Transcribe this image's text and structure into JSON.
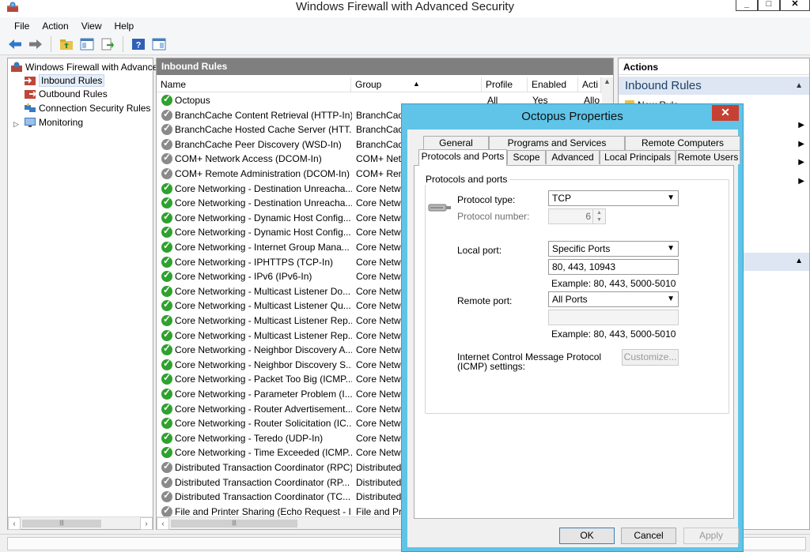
{
  "window": {
    "title": "Windows Firewall with Advanced Security"
  },
  "menu": [
    "File",
    "Action",
    "View",
    "Help"
  ],
  "tree": {
    "root": "Windows Firewall with Advance",
    "items": [
      "Inbound Rules",
      "Outbound Rules",
      "Connection Security Rules",
      "Monitoring"
    ]
  },
  "rules": {
    "header": "Inbound Rules",
    "columns": {
      "name": "Name",
      "group": "Group",
      "profile": "Profile",
      "enabled": "Enabled",
      "action": "Acti"
    },
    "rows": [
      {
        "name": "Octopus",
        "group": "",
        "profile": "All",
        "enabled": "Yes",
        "action": "Allo",
        "on": true
      },
      {
        "name": "BranchCache Content Retrieval (HTTP-In)",
        "group": "BranchCach",
        "on": false
      },
      {
        "name": "BranchCache Hosted Cache Server (HTT...",
        "group": "BranchCach",
        "on": false
      },
      {
        "name": "BranchCache Peer Discovery (WSD-In)",
        "group": "BranchCach",
        "on": false
      },
      {
        "name": "COM+ Network Access (DCOM-In)",
        "group": "COM+ Netw",
        "on": false
      },
      {
        "name": "COM+ Remote Administration (DCOM-In)",
        "group": "COM+ Rem",
        "on": false
      },
      {
        "name": "Core Networking - Destination Unreacha...",
        "group": "Core Netwo",
        "on": true
      },
      {
        "name": "Core Networking - Destination Unreacha...",
        "group": "Core Netwo",
        "on": true
      },
      {
        "name": "Core Networking - Dynamic Host Config...",
        "group": "Core Netwo",
        "on": true
      },
      {
        "name": "Core Networking - Dynamic Host Config...",
        "group": "Core Netwo",
        "on": true
      },
      {
        "name": "Core Networking - Internet Group Mana...",
        "group": "Core Netwo",
        "on": true
      },
      {
        "name": "Core Networking - IPHTTPS (TCP-In)",
        "group": "Core Netwo",
        "on": true
      },
      {
        "name": "Core Networking - IPv6 (IPv6-In)",
        "group": "Core Netwo",
        "on": true
      },
      {
        "name": "Core Networking - Multicast Listener Do...",
        "group": "Core Netwo",
        "on": true
      },
      {
        "name": "Core Networking - Multicast Listener Qu...",
        "group": "Core Netwo",
        "on": true
      },
      {
        "name": "Core Networking - Multicast Listener Rep...",
        "group": "Core Netwo",
        "on": true
      },
      {
        "name": "Core Networking - Multicast Listener Rep...",
        "group": "Core Netwo",
        "on": true
      },
      {
        "name": "Core Networking - Neighbor Discovery A...",
        "group": "Core Netwo",
        "on": true
      },
      {
        "name": "Core Networking - Neighbor Discovery S...",
        "group": "Core Netwo",
        "on": true
      },
      {
        "name": "Core Networking - Packet Too Big (ICMP...",
        "group": "Core Netwo",
        "on": true
      },
      {
        "name": "Core Networking - Parameter Problem (I...",
        "group": "Core Netwo",
        "on": true
      },
      {
        "name": "Core Networking - Router Advertisement...",
        "group": "Core Netwo",
        "on": true
      },
      {
        "name": "Core Networking - Router Solicitation (IC...",
        "group": "Core Netwo",
        "on": true
      },
      {
        "name": "Core Networking - Teredo (UDP-In)",
        "group": "Core Netwo",
        "on": true
      },
      {
        "name": "Core Networking - Time Exceeded (ICMP...",
        "group": "Core Netwo",
        "on": true
      },
      {
        "name": "Distributed Transaction Coordinator (RPC)",
        "group": "Distributed",
        "on": false
      },
      {
        "name": "Distributed Transaction Coordinator (RP...",
        "group": "Distributed",
        "on": false
      },
      {
        "name": "Distributed Transaction Coordinator (TC...",
        "group": "Distributed",
        "on": false
      },
      {
        "name": "File and Printer Sharing (Echo Request - I...",
        "group": "File and Pri",
        "on": false
      }
    ]
  },
  "actions": {
    "header": "Actions",
    "section": "Inbound Rules",
    "first_item": "New Rule..."
  },
  "dialog": {
    "title": "Octopus Properties",
    "tabs_row1": [
      "General",
      "Programs and Services",
      "Remote Computers"
    ],
    "tabs_row2": [
      "Protocols and Ports",
      "Scope",
      "Advanced",
      "Local Principals",
      "Remote Users"
    ],
    "group_label": "Protocols and ports",
    "protocol_type_label": "Protocol type:",
    "protocol_type_value": "TCP",
    "protocol_number_label": "Protocol number:",
    "protocol_number_value": "6",
    "local_port_label": "Local port:",
    "local_port_mode": "Specific Ports",
    "local_port_value": "80, 443, 10943",
    "local_port_example": "Example: 80, 443, 5000-5010",
    "remote_port_label": "Remote port:",
    "remote_port_mode": "All Ports",
    "remote_port_value": "",
    "remote_port_example": "Example: 80, 443, 5000-5010",
    "icmp_label_1": "Internet Control Message Protocol",
    "icmp_label_2": "(ICMP) settings:",
    "customize": "Customize...",
    "ok": "OK",
    "cancel": "Cancel",
    "apply": "Apply"
  }
}
